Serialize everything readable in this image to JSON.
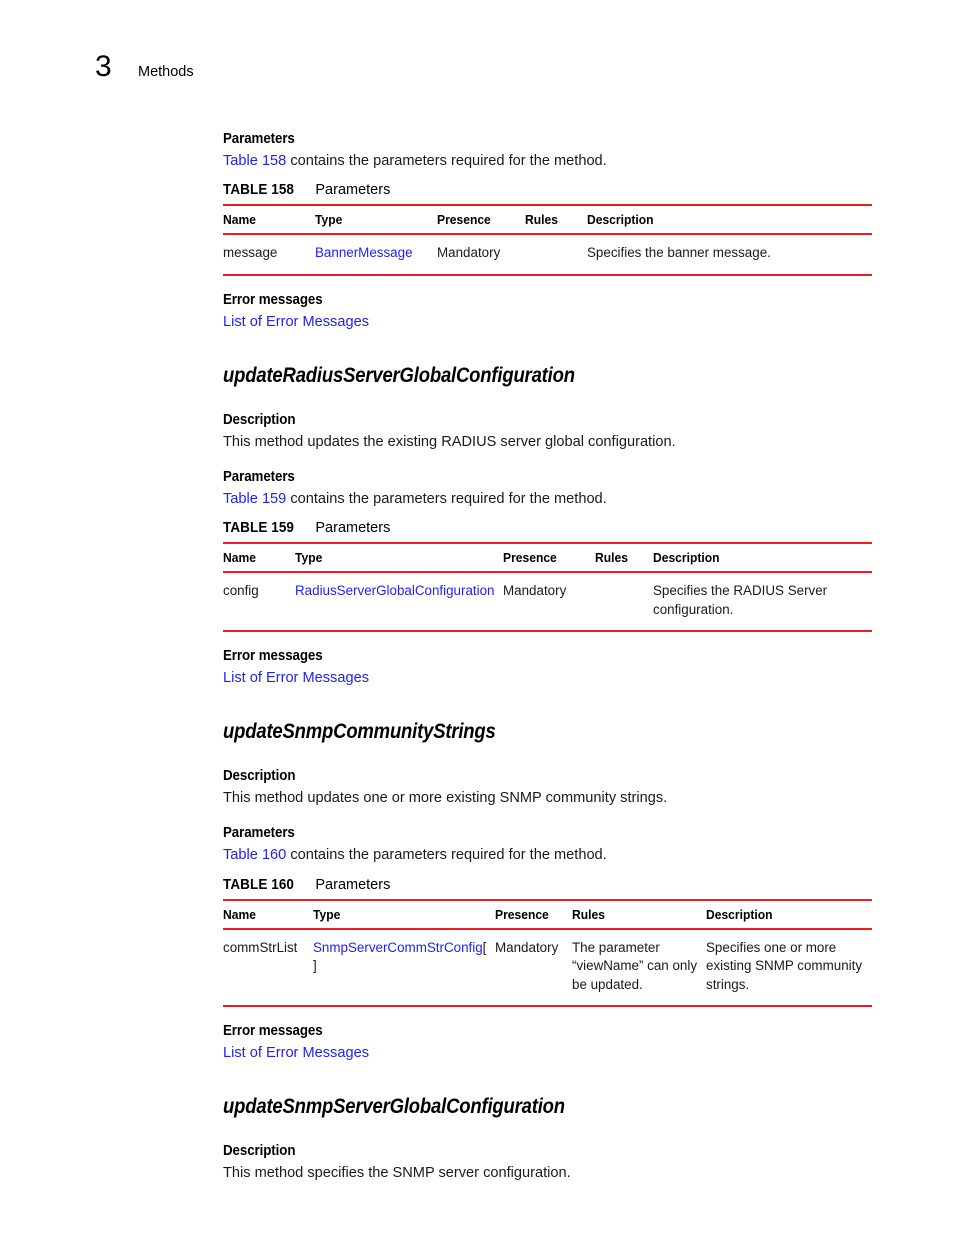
{
  "page": {
    "chapter_number": "3",
    "chapter_title": "Methods"
  },
  "labels": {
    "parameters": "Parameters",
    "description": "Description",
    "error_messages": "Error messages",
    "error_link": "List of Error Messages"
  },
  "colors": {
    "link": "#2222ee",
    "rule": "#ed1b24",
    "text": "#1a1a1a"
  },
  "columns": [
    "Name",
    "Type",
    "Presence",
    "Rules",
    "Description"
  ],
  "sections": [
    {
      "id": "banner-message-section",
      "parameters_intro": {
        "link": "Table 158",
        "rest": " contains the parameters required for the method."
      },
      "table": {
        "caption_label": "TABLE 158",
        "caption_title": "Parameters",
        "columns": [
          "Name",
          "Type",
          "Presence",
          "Rules",
          "Description"
        ],
        "rows": [
          {
            "name": "message",
            "type": "BannerMessage",
            "type_suffix": "",
            "presence": "Mandatory",
            "rules": "",
            "description": "Specifies the banner message."
          }
        ]
      }
    },
    {
      "id": "update-radius-server-global-configuration",
      "heading": "updateRadiusServerGlobalConfiguration",
      "description_text": "This method updates the existing RADIUS server global configuration.",
      "parameters_intro": {
        "link": "Table 159",
        "rest": " contains the parameters required for the method."
      },
      "table": {
        "caption_label": "TABLE 159",
        "caption_title": "Parameters",
        "columns": [
          "Name",
          "Type",
          "Presence",
          "Rules",
          "Description"
        ],
        "rows": [
          {
            "name": "config",
            "type": "RadiusServerGlobalConfiguration",
            "type_suffix": "",
            "presence": "Mandatory",
            "rules": "",
            "description": "Specifies the RADIUS Server configuration."
          }
        ]
      }
    },
    {
      "id": "update-snmp-community-strings",
      "heading": "updateSnmpCommunityStrings",
      "description_text": "This method updates one or more existing SNMP community strings.",
      "parameters_intro": {
        "link": "Table 160",
        "rest": " contains the parameters required for the method."
      },
      "table": {
        "caption_label": "TABLE 160",
        "caption_title": "Parameters",
        "columns": [
          "Name",
          "Type",
          "Presence",
          "Rules",
          "Description"
        ],
        "rows": [
          {
            "name": "commStrList",
            "type": "SnmpServerCommStrConfig",
            "type_suffix": "[ ]",
            "presence": "Mandatory",
            "rules": "The parameter “viewName” can only be updated.",
            "description": "Specifies one or more existing SNMP community strings."
          }
        ]
      }
    },
    {
      "id": "update-snmp-server-global-configuration",
      "heading": "updateSnmpServerGlobalConfiguration",
      "description_text": "This method specifies the SNMP server configuration."
    }
  ]
}
